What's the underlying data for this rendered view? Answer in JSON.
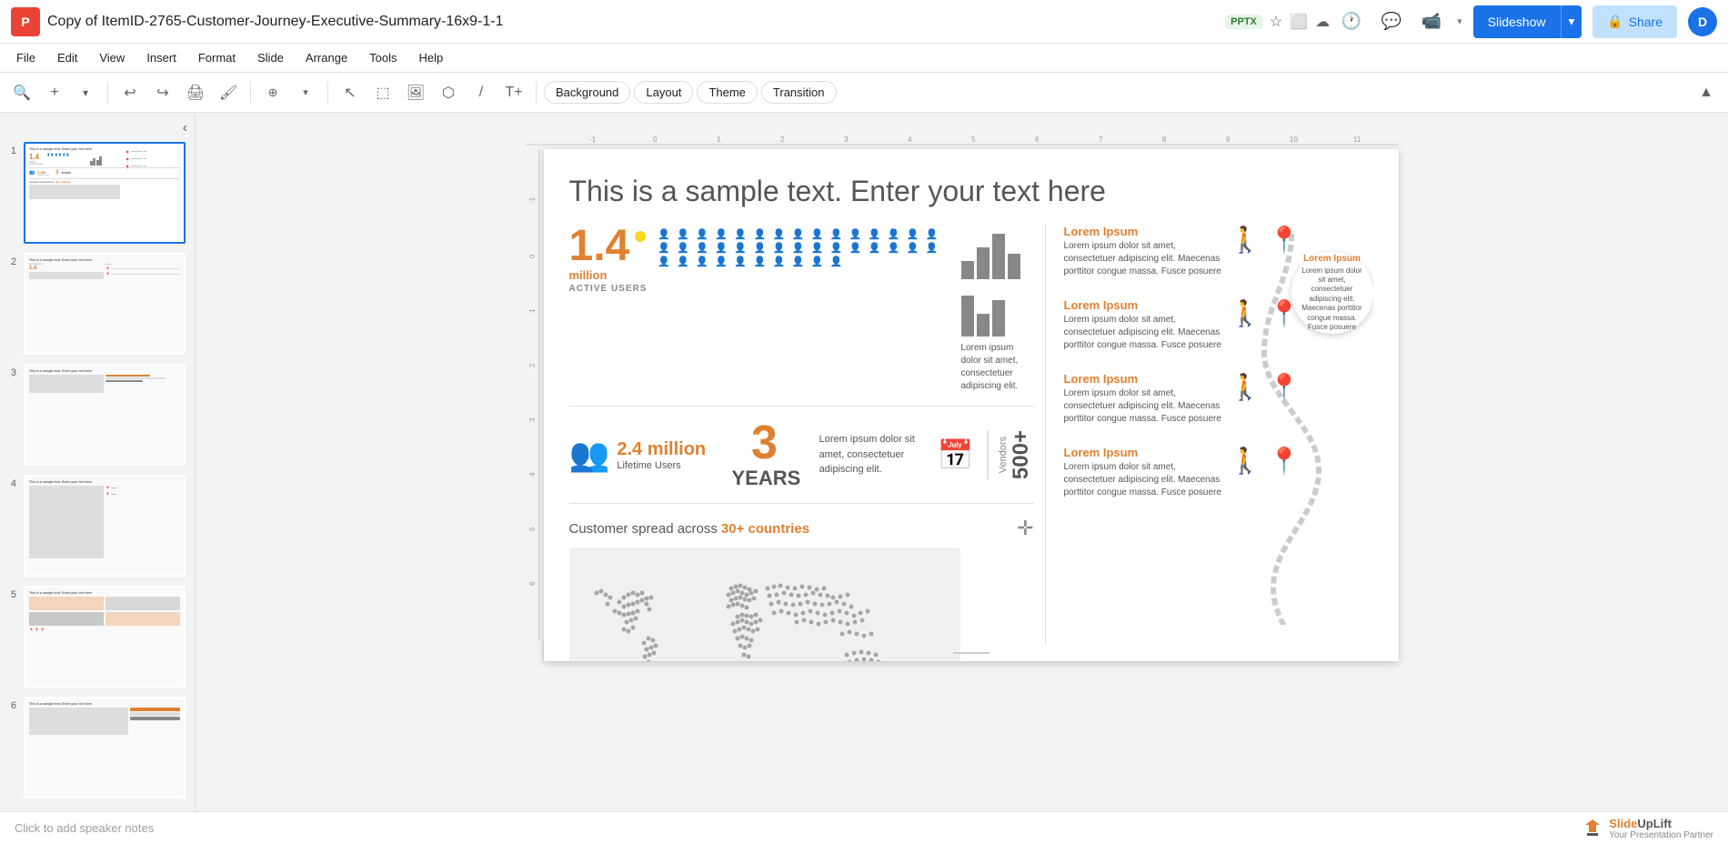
{
  "app": {
    "logo_letter": "P",
    "title": "Copy of ItemID-2765-Customer-Journey-Executive-Summary-16x9-1-1",
    "file_type": "PPTX",
    "star_icon": "☆",
    "drive_icon": "🔒",
    "cloud_icon": "☁"
  },
  "title_bar": {
    "history_icon": "⟲",
    "comment_icon": "💬",
    "video_icon": "📹",
    "slideshow_label": "Slideshow",
    "dropdown_icon": "▾",
    "share_icon": "🔒",
    "share_label": "Share",
    "avatar_letter": "D"
  },
  "menu": {
    "items": [
      "File",
      "Edit",
      "View",
      "Insert",
      "Format",
      "Slide",
      "Arrange",
      "Tools",
      "Help"
    ]
  },
  "toolbar": {
    "search_icon": "🔍",
    "zoom_in": "+",
    "undo": "↩",
    "redo": "↪",
    "print": "🖨",
    "paint": "🖌",
    "zoom": "🔍",
    "cursor": "↖",
    "select": "⬚",
    "image": "🖼",
    "shapes": "◎",
    "line": "/",
    "textbox": "T",
    "background_label": "Background",
    "layout_label": "Layout",
    "theme_label": "Theme",
    "transition_label": "Transition",
    "collapse_icon": "▲"
  },
  "slides": [
    {
      "number": "1",
      "active": true
    },
    {
      "number": "2",
      "active": false
    },
    {
      "number": "3",
      "active": false
    },
    {
      "number": "4",
      "active": false
    },
    {
      "number": "5",
      "active": false
    },
    {
      "number": "6",
      "active": false
    }
  ],
  "slide": {
    "title": "This is a sample text. Enter your text here",
    "stats": {
      "active_users_number": "1.4",
      "active_users_unit": "million",
      "active_users_label": "ACTIVE USERS",
      "lorem_text": "Lorem ipsum dolor sit amet, consectetuer adipiscing elit.",
      "lifetime_users_number": "2.4 million",
      "lifetime_users_label": "Lifetime Users",
      "years_number": "3",
      "years_label": "YEARS",
      "years_desc": "Lorem ipsum dolor sit amet,      consectetuer adipiscing elit.",
      "vendors_number": "500+",
      "vendors_label": "Vendors"
    },
    "countries": {
      "text": "Customer spread across ",
      "highlight": "30+ countries"
    },
    "journey": {
      "points": [
        {
          "title": "Lorem Ipsum",
          "desc": "Lorem ipsum dolor sit amet, consectetuer adipiscing elit. Maecenas porttitor congue massa. Fusce posuere"
        },
        {
          "title": "Lorem Ipsum",
          "desc": "Lorem ipsum dolor sit amet, consectetuer adipiscing elit. Maecenas porttitor congue massa. Fusce posuere"
        },
        {
          "title": "Lorem Ipsum",
          "desc": "Lorem ipsum dolor sit amet, consectetuer adipiscing elit. Maecenas porttitor congue massa. Fusce posuere"
        },
        {
          "title": "Lorem Ipsum",
          "desc": "Lorem ipsum dolor sit amet, consectetuer adipiscing elit. Maecenas porttitor congue massa. Fusce posuere"
        }
      ],
      "floating_card_title": "Lorem Ipsum",
      "floating_card_desc": "Lorem ipsum dolor sit amet, consectetuer adipiscing elit. Maecenas porttitor congue massa.    Fusce posuere"
    }
  },
  "bottom": {
    "notes_placeholder": "Click to add speaker notes",
    "brand_name": "SlideUpLift",
    "brand_subtitle": "Your Presentation Partner"
  },
  "colors": {
    "orange": "#e08030",
    "blue": "#1a73e8",
    "gray": "#888",
    "dark": "#444"
  }
}
